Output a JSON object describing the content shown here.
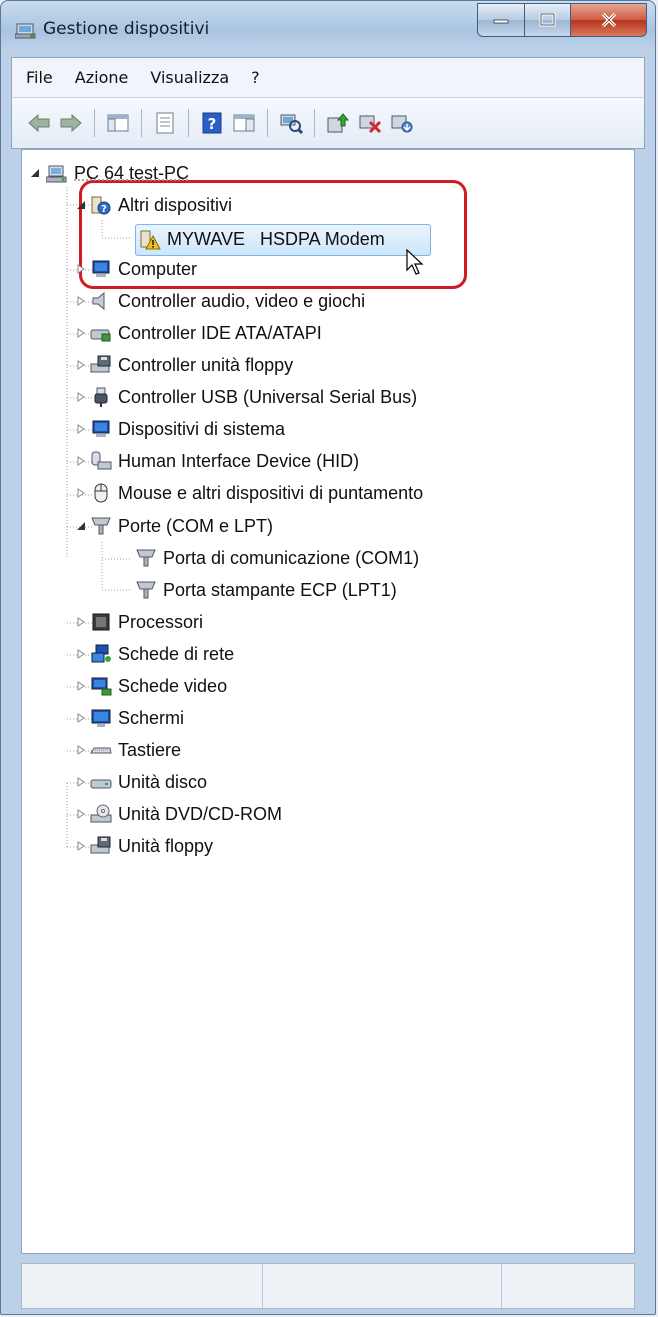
{
  "window": {
    "title": "Gestione dispositivi",
    "icon": "device-manager-icon"
  },
  "caption_buttons": [
    {
      "name": "minimize-button",
      "icon": "minimize-icon"
    },
    {
      "name": "maximize-button",
      "icon": "maximize-icon"
    },
    {
      "name": "close-button",
      "icon": "close-icon"
    }
  ],
  "menu": [
    "File",
    "Azione",
    "Visualizza",
    "?"
  ],
  "toolbar": {
    "buttons": [
      "back-arrow-icon",
      "forward-arrow-icon",
      "show-hide-console-tree-icon",
      "properties-icon",
      "help-icon",
      "action-pane-icon",
      "scan-hardware-icon",
      "update-driver-icon",
      "disable-device-icon",
      "uninstall-device-icon"
    ]
  },
  "tree": {
    "root": "PC 64 test-PC",
    "altri_dispositivi": "Altri dispositivi",
    "modem": "MYWAVE   HSDPA Modem",
    "computer": "Computer",
    "audio": "Controller audio, video e giochi",
    "ide": "Controller IDE ATA/ATAPI",
    "floppy_ctrl": "Controller unità floppy",
    "usb": "Controller USB (Universal Serial Bus)",
    "sistema": "Dispositivi di sistema",
    "hid": "Human Interface Device (HID)",
    "mouse": "Mouse e altri dispositivi di puntamento",
    "porte": "Porte (COM e LPT)",
    "com1": "Porta di comunicazione (COM1)",
    "lpt1": "Porta stampante ECP (LPT1)",
    "processori": "Processori",
    "rete": "Schede di rete",
    "video": "Schede video",
    "schermi": "Schermi",
    "tastiere": "Tastiere",
    "disco": "Unità disco",
    "dvd": "Unità DVD/CD-ROM",
    "floppy": "Unità floppy"
  },
  "colors": {
    "highlight_border": "#d11a24",
    "selection": "#cde6fb"
  }
}
